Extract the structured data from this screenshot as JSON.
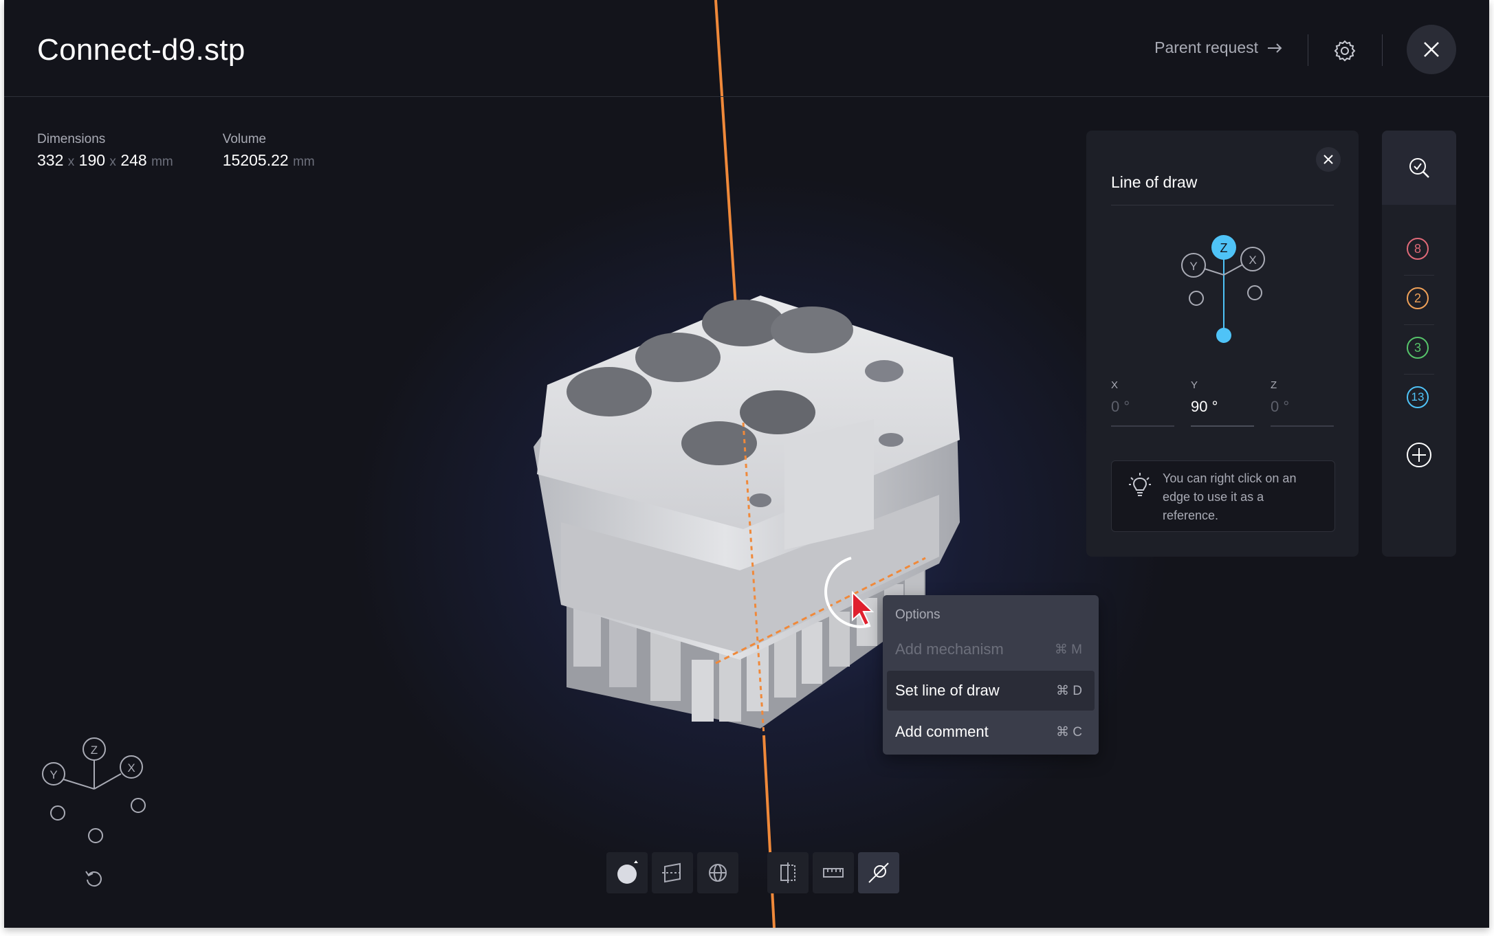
{
  "header": {
    "title": "Connect-d9.stp",
    "parent_request_label": "Parent request"
  },
  "metrics": {
    "dimensions_label": "Dimensions",
    "dim_x": "332",
    "dim_sep1": "x",
    "dim_y": "190",
    "dim_sep2": "x",
    "dim_z": "248",
    "dim_unit": "mm",
    "volume_label": "Volume",
    "volume_value": "15205.22",
    "volume_unit": "mm"
  },
  "line_of_draw": {
    "title": "Line of draw",
    "gizmo": {
      "z": "Z",
      "y": "Y",
      "x": "X"
    },
    "coords": [
      {
        "label": "X",
        "value": "0 °"
      },
      {
        "label": "Y",
        "value": "90 °"
      },
      {
        "label": "Z",
        "value": "0 °"
      }
    ],
    "tip": "You can right click on an edge to use it as a reference."
  },
  "rail": {
    "badges": [
      {
        "value": "8",
        "color": "#e06a78"
      },
      {
        "value": "2",
        "color": "#f0a158"
      },
      {
        "value": "3",
        "color": "#56c46a"
      },
      {
        "value": "13",
        "color": "#4fc3f7"
      }
    ]
  },
  "context_menu": {
    "header": "Options",
    "items": [
      {
        "label": "Add mechanism",
        "shortcut": "⌘ M",
        "state": "disabled"
      },
      {
        "label": "Set line of draw",
        "shortcut": "⌘ D",
        "state": "selected"
      },
      {
        "label": "Add comment",
        "shortcut": "⌘ C",
        "state": "normal"
      }
    ]
  },
  "view_gizmo": {
    "z": "Z",
    "y": "Y",
    "x": "X"
  },
  "colors": {
    "accent_blue": "#4fc3f7",
    "line_of_draw_orange": "#f0893a",
    "background": "#13141b",
    "panel": "#1d1f27"
  }
}
